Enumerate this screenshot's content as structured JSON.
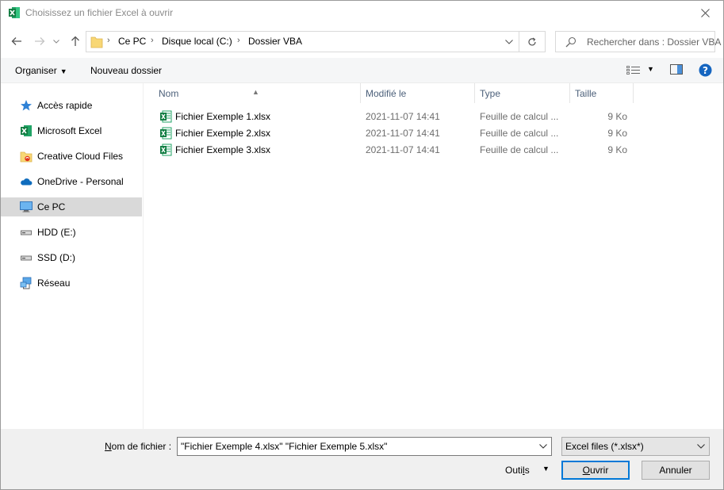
{
  "window": {
    "title": "Choisissez un fichier Excel à ouvrir",
    "accent": "#0078d7"
  },
  "address": {
    "crumbs": [
      "Ce PC",
      "Disque local (C:)",
      "Dossier VBA"
    ],
    "search_placeholder": "Rechercher dans : Dossier VBA"
  },
  "commands": {
    "organize": "Organiser",
    "new_folder": "Nouveau dossier"
  },
  "sidebar": {
    "items": [
      {
        "label": "Accès rapide",
        "icon": "star-icon"
      },
      {
        "label": "Microsoft Excel",
        "icon": "excel-icon"
      },
      {
        "label": "Creative Cloud Files",
        "icon": "creative-cloud-folder-icon"
      },
      {
        "label": "OneDrive - Personal",
        "icon": "onedrive-cloud-icon"
      },
      {
        "label": "Ce PC",
        "icon": "computer-icon",
        "active": true
      },
      {
        "label": "HDD (E:)",
        "icon": "drive-icon"
      },
      {
        "label": "SSD (D:)",
        "icon": "drive-icon"
      },
      {
        "label": "Réseau",
        "icon": "network-icon"
      }
    ]
  },
  "columns": {
    "name": "Nom",
    "modified": "Modifié le",
    "type": "Type",
    "size": "Taille"
  },
  "files": [
    {
      "name": "Fichier Exemple 1.xlsx",
      "modified": "2021-11-07 14:41",
      "type": "Feuille de calcul ...",
      "size": "9 Ko"
    },
    {
      "name": "Fichier Exemple 2.xlsx",
      "modified": "2021-11-07 14:41",
      "type": "Feuille de calcul ...",
      "size": "9 Ko"
    },
    {
      "name": "Fichier Exemple 3.xlsx",
      "modified": "2021-11-07 14:41",
      "type": "Feuille de calcul ...",
      "size": "9 Ko"
    }
  ],
  "footer": {
    "filename_label_u": "N",
    "filename_label_rest": "om de fichier :",
    "filename_value": "\"Fichier Exemple 4.xlsx\" \"Fichier Exemple 5.xlsx\"",
    "filter_value": "Excel files (*.xlsx*)",
    "tools_label_a": "Outi",
    "tools_label_u": "l",
    "tools_label_b": "s",
    "open_u": "O",
    "open_rest": "uvrir",
    "cancel": "Annuler"
  }
}
